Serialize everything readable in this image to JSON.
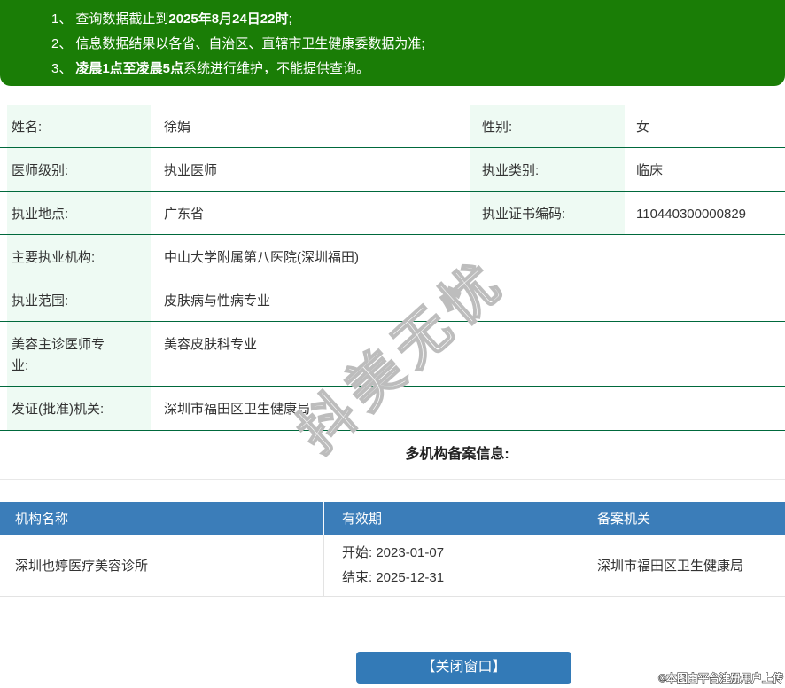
{
  "notices": {
    "items": [
      {
        "num": "1、",
        "pre": "查询数据截止到",
        "bold": "2025年8月24日22时",
        "post": ";"
      },
      {
        "num": "2、",
        "pre": "信息数据结果以各省、自治区、直辖市卫生健康委数据为准;",
        "bold": "",
        "post": ""
      },
      {
        "num": "3、",
        "pre": "",
        "bold": "凌晨1点至凌晨5点",
        "post": "系统进行维护，不能提供查询。"
      }
    ]
  },
  "doctor": {
    "rows": [
      {
        "label": "姓名:",
        "value": "徐娟",
        "label2": "性别:",
        "value2": "女"
      },
      {
        "label": "医师级别:",
        "value": "执业医师",
        "label2": "执业类别:",
        "value2": "临床"
      },
      {
        "label": "执业地点:",
        "value": "广东省",
        "label2": "执业证书编码:",
        "value2": "110440300000829"
      },
      {
        "label": "主要执业机构:",
        "value": "中山大学附属第八医院(深圳福田)"
      },
      {
        "label": "执业范围:",
        "value": "皮肤病与性病专业"
      },
      {
        "label": "美容主诊医师专业:",
        "value": "美容皮肤科专业"
      },
      {
        "label": "发证(批准)机关:",
        "value": "深圳市福田区卫生健康局"
      }
    ]
  },
  "filing": {
    "title": "多机构备案信息:",
    "headers": [
      "机构名称",
      "有效期",
      "备案机关"
    ],
    "rows": [
      {
        "org": "深圳也婷医疗美容诊所",
        "valid_start": "开始: 2023-01-07",
        "valid_end": "结束: 2025-12-31",
        "authority": "深圳市福田区卫生健康局"
      }
    ]
  },
  "close_button": {
    "label": "【关闭窗口】"
  },
  "watermark": {
    "text": "抖美无忧"
  },
  "footer": {
    "credit": "©本图由平台注册用户上传"
  },
  "colors": {
    "banner_green": "#1a7d06",
    "row_border_green": "#00693c",
    "label_cell_mint": "#eefaf3",
    "table_header_blue": "#3b7db9",
    "button_blue": "#337ab7"
  }
}
